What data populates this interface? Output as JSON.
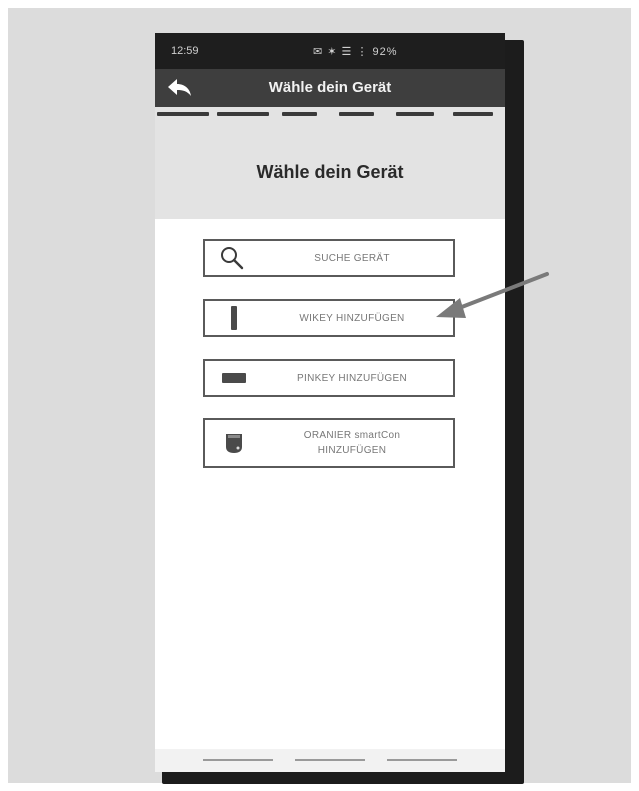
{
  "status_bar": {
    "time": "12:59",
    "icons_text": "✉ ✶ ☰ ⋮ 92%",
    "battery": "92%"
  },
  "app_bar": {
    "title": "Wähle dein Gerät",
    "back_icon": "back-arrow-icon"
  },
  "progress_steps": 6,
  "heading": "Wähle dein Gerät",
  "buttons": [
    {
      "label": "SUCHE GERÄT",
      "icon": "search-icon"
    },
    {
      "label": "WIKEY HINZUFÜGEN",
      "icon": "wikey-device-icon"
    },
    {
      "label": "PINKEY HINZUFÜGEN",
      "icon": "pinkey-device-icon"
    },
    {
      "label": "ORANIER smartCon HINZUFÜGEN",
      "icon": "smartcon-device-icon"
    }
  ],
  "colors": {
    "app_bar": "#3e3e3e",
    "status_bar": "#1e1e1e",
    "header_bg": "#e3e3e3",
    "button_border": "#5a5a5a",
    "button_text": "#777777",
    "callout_arrow": "#7a7a7a"
  }
}
